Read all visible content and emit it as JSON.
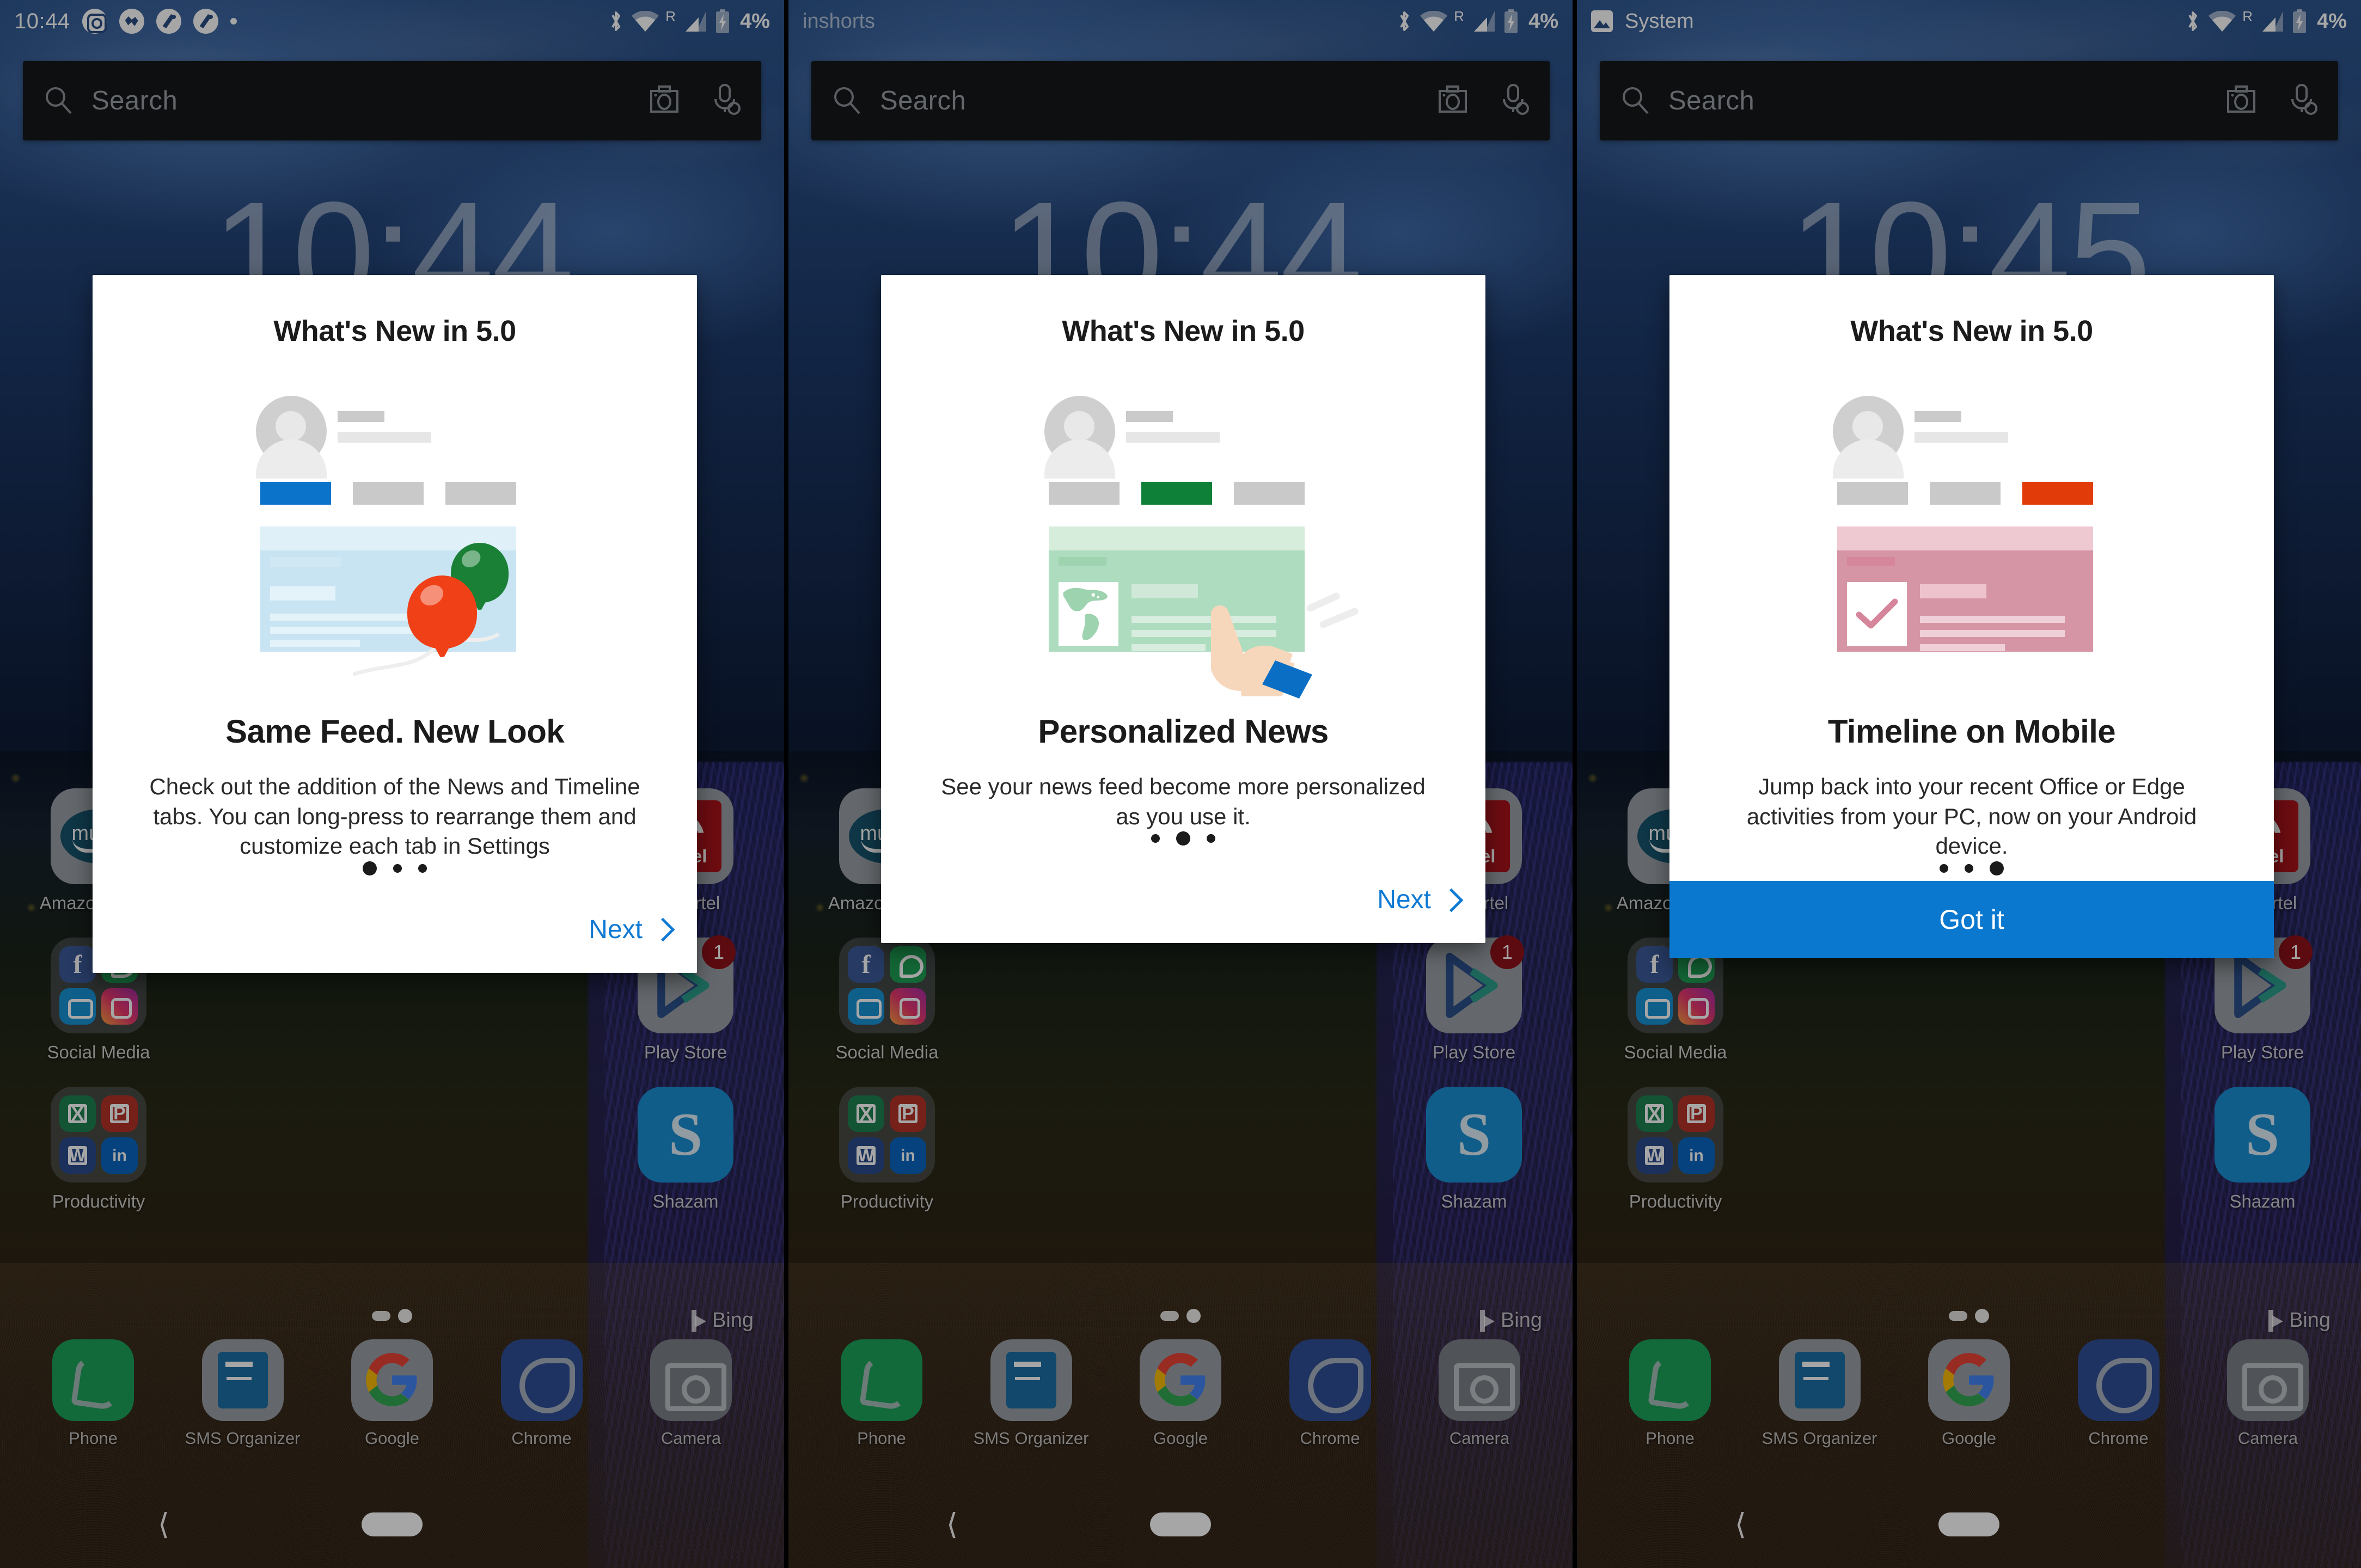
{
  "panels": [
    {
      "status": {
        "clock": "10:44",
        "notif_icons": [
          "instagram-icon",
          "messenger-icon",
          "strava-icon",
          "strava-icon",
          "dot-icon"
        ],
        "notif_text": "",
        "battery": "4%",
        "roaming": "R"
      },
      "widget_clock": "10:44",
      "search": {
        "placeholder": "Search",
        "camera_icon": "camera-icon",
        "mic_icon": "microphone-icon"
      },
      "card": {
        "title": "What's New in 5.0",
        "heading": "Same Feed. New Look",
        "body": "Check out the addition of the News and Timeline tabs. You can long-press to rearrange them and customize each tab in Settings",
        "dots_total": 3,
        "dots_active": 1,
        "action_label": "Next",
        "action_type": "next",
        "accent": "#0f7ad4",
        "illustration": {
          "theme": "blue",
          "active_tab_color": "#0b73c9",
          "feed_header_color": "#dff0f8",
          "feed_body_color": "#c8e4f2",
          "balloons": [
            "#ef4018",
            "#1a8036"
          ]
        }
      }
    },
    {
      "status": {
        "clock": "",
        "notif_icons": [],
        "notif_text": "inshorts",
        "battery": "4%",
        "roaming": "R"
      },
      "widget_clock": "10:44",
      "search": {
        "placeholder": "Search",
        "camera_icon": "camera-icon",
        "mic_icon": "microphone-icon"
      },
      "card": {
        "title": "What's New in 5.0",
        "heading": "Personalized News",
        "body": "See your news feed become more personalized as you use it.",
        "dots_total": 3,
        "dots_active": 2,
        "action_label": "Next",
        "action_type": "next",
        "accent": "#0f7ad4",
        "illustration": {
          "theme": "green",
          "active_tab_color": "#0f8038",
          "feed_header_color": "#d6eddc",
          "feed_body_color": "#addcbe",
          "thumbnail": "world-map-icon",
          "hand": "pointing-hand-icon",
          "cuff_color": "#0a6fc4"
        }
      }
    },
    {
      "status": {
        "clock": "",
        "notif_icons": [
          "system-image-icon"
        ],
        "notif_text": "System",
        "battery": "4%",
        "roaming": "R"
      },
      "widget_clock": "10:45",
      "search": {
        "placeholder": "Search",
        "camera_icon": "camera-icon",
        "mic_icon": "microphone-icon"
      },
      "card": {
        "title": "What's New in 5.0",
        "heading": "Timeline on Mobile",
        "body": "Jump back into your recent Office or Edge activities from your PC, now on your Android device.",
        "dots_total": 3,
        "dots_active": 3,
        "action_label": "Got it",
        "action_type": "gotit",
        "accent": "#0a78cf",
        "illustration": {
          "theme": "pink",
          "active_tab_color": "#e13b09",
          "feed_header_color": "#efc9d1",
          "feed_body_color": "#d695a4",
          "thumbnail": "checkmark-icon"
        }
      }
    }
  ],
  "homescreen": {
    "rows": [
      [
        {
          "label": "Amazon Music",
          "icon": "amazon-music-icon",
          "badge": ""
        },
        {
          "label": "My Airtel",
          "icon": "airtel-icon",
          "badge": ""
        }
      ],
      [
        {
          "label": "Social Media",
          "icon": "social-media-folder-icon",
          "badge": ""
        },
        {
          "label": "Play Store",
          "icon": "play-store-icon",
          "badge": "1"
        }
      ],
      [
        {
          "label": "Productivity",
          "icon": "productivity-folder-icon",
          "badge": ""
        },
        {
          "label": "Shazam",
          "icon": "shazam-icon",
          "badge": ""
        }
      ]
    ],
    "dock": [
      {
        "label": "Phone",
        "icon": "phone-icon"
      },
      {
        "label": "SMS Organizer",
        "icon": "sms-organizer-icon"
      },
      {
        "label": "Google",
        "icon": "google-icon"
      },
      {
        "label": "Chrome",
        "icon": "chrome-icon"
      },
      {
        "label": "Camera",
        "icon": "camera-app-icon"
      }
    ],
    "branding": "Bing",
    "page_indicator": {
      "pages": 2,
      "active": 2
    }
  },
  "navbar": {
    "back_icon": "back-chevron-icon",
    "home_icon": "home-pill-icon"
  }
}
